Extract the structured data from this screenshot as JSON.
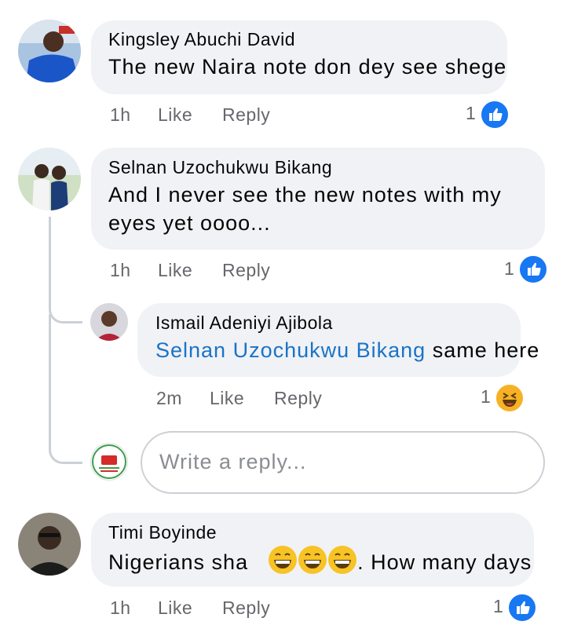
{
  "comments": [
    {
      "author": "Kingsley Abuchi David",
      "text": "The new Naira note don dey see shege",
      "time": "1h",
      "like_label": "Like",
      "reply_label": "Reply",
      "reaction_count": "1",
      "reaction_type": "like-icon"
    },
    {
      "author": "Selnan Uzochukwu Bikang",
      "text_line1": "And I never see the new notes with my",
      "text_line2": "eyes yet oooo...",
      "time": "1h",
      "like_label": "Like",
      "reply_label": "Reply",
      "reaction_count": "1",
      "reaction_type": "like-icon",
      "reply": {
        "author": "Ismail Adeniyi Ajibola",
        "mention": "Selnan Uzochukwu Bikang",
        "text": "same here",
        "time": "2m",
        "like_label": "Like",
        "reply_label": "Reply",
        "reaction_count": "1",
        "reaction_type": "haha-icon"
      },
      "reply_input": {
        "placeholder": "Write a reply..."
      }
    },
    {
      "author": "Timi Boyinde",
      "text_before": "Nigerians sha",
      "emoji": "grinning-face-icon",
      "text_after": ". How many days",
      "time": "1h",
      "like_label": "Like",
      "reply_label": "Reply",
      "reaction_count": "1",
      "reaction_type": "like-icon"
    }
  ],
  "colors": {
    "bubble": "#f0f2f5",
    "like_blue": "#1877f2",
    "mention_blue": "#1a73c8",
    "meta_gray": "#65676b"
  }
}
